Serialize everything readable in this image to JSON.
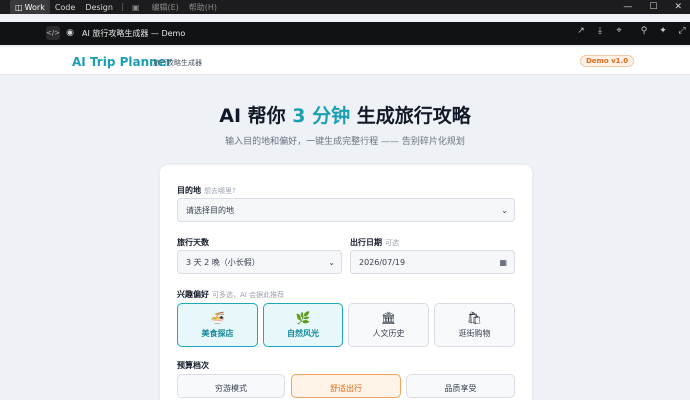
{
  "menubar": {
    "items": [
      {
        "label": "Work",
        "icon": "panel-icon",
        "glyph": "◫"
      },
      {
        "label": "Code"
      },
      {
        "label": "Design"
      }
    ],
    "dim_items": [
      {
        "label": "",
        "icon": "layout-icon",
        "glyph": "▣"
      },
      {
        "label": "编辑(E)"
      },
      {
        "label": "帮助(H)"
      }
    ],
    "window_controls": [
      "—",
      "☐",
      "✕"
    ]
  },
  "toolbar": {
    "code_glyph": "</>",
    "eye_glyph": "◉",
    "title": "AI 旅行攻略生成器 — Demo",
    "right_icons": [
      {
        "name": "open-external-icon",
        "glyph": "↗"
      },
      {
        "name": "download-icon",
        "glyph": "⤓"
      },
      {
        "name": "cursor-icon",
        "glyph": "⌖"
      },
      {
        "name": "pin-icon",
        "glyph": "⚲"
      },
      {
        "name": "sparkle-icon",
        "glyph": "✦"
      },
      {
        "name": "fullscreen-icon",
        "glyph": "⤢"
      }
    ]
  },
  "header": {
    "brand": "AI Trip Planner",
    "brand_sub": "旅行攻略生成器",
    "badge": "Demo v1.0"
  },
  "hero": {
    "title_prefix": "AI 帮你 ",
    "title_highlight": "3 分钟",
    "title_suffix": " 生成旅行攻略",
    "subtitle": "输入目的地和偏好，一键生成完整行程 —— 告别碎片化规划"
  },
  "form": {
    "destination": {
      "label": "目的地",
      "hint": "想去哪里?",
      "placeholder": "请选择目的地"
    },
    "days": {
      "label": "旅行天数",
      "value": "3 天 2 晚（小长假）"
    },
    "date": {
      "label": "出行日期",
      "hint": "可选",
      "value": "2026/07/19"
    },
    "interests": {
      "label": "兴趣偏好",
      "hint": "可多选，AI 会据此推荐",
      "options": [
        {
          "label": "美食探店",
          "icon": "noodle-bowl-icon",
          "glyph": "🍜",
          "selected": true
        },
        {
          "label": "自然风光",
          "icon": "leaf-icon",
          "glyph": "🌿",
          "selected": true
        },
        {
          "label": "人文历史",
          "icon": "temple-icon",
          "glyph": "🏛",
          "selected": false
        },
        {
          "label": "逛街购物",
          "icon": "shopping-bag-icon",
          "glyph": "🛍",
          "selected": false
        }
      ]
    },
    "budget": {
      "label": "预算档次",
      "options": [
        {
          "label": "穷游模式",
          "selected": false
        },
        {
          "label": "舒适出行",
          "selected": true
        },
        {
          "label": "品质享受",
          "selected": false
        }
      ]
    }
  },
  "colors": {
    "accent": "#1a9eb4",
    "accent_orange": "#ea6a1c",
    "background": "#eef1f5"
  }
}
